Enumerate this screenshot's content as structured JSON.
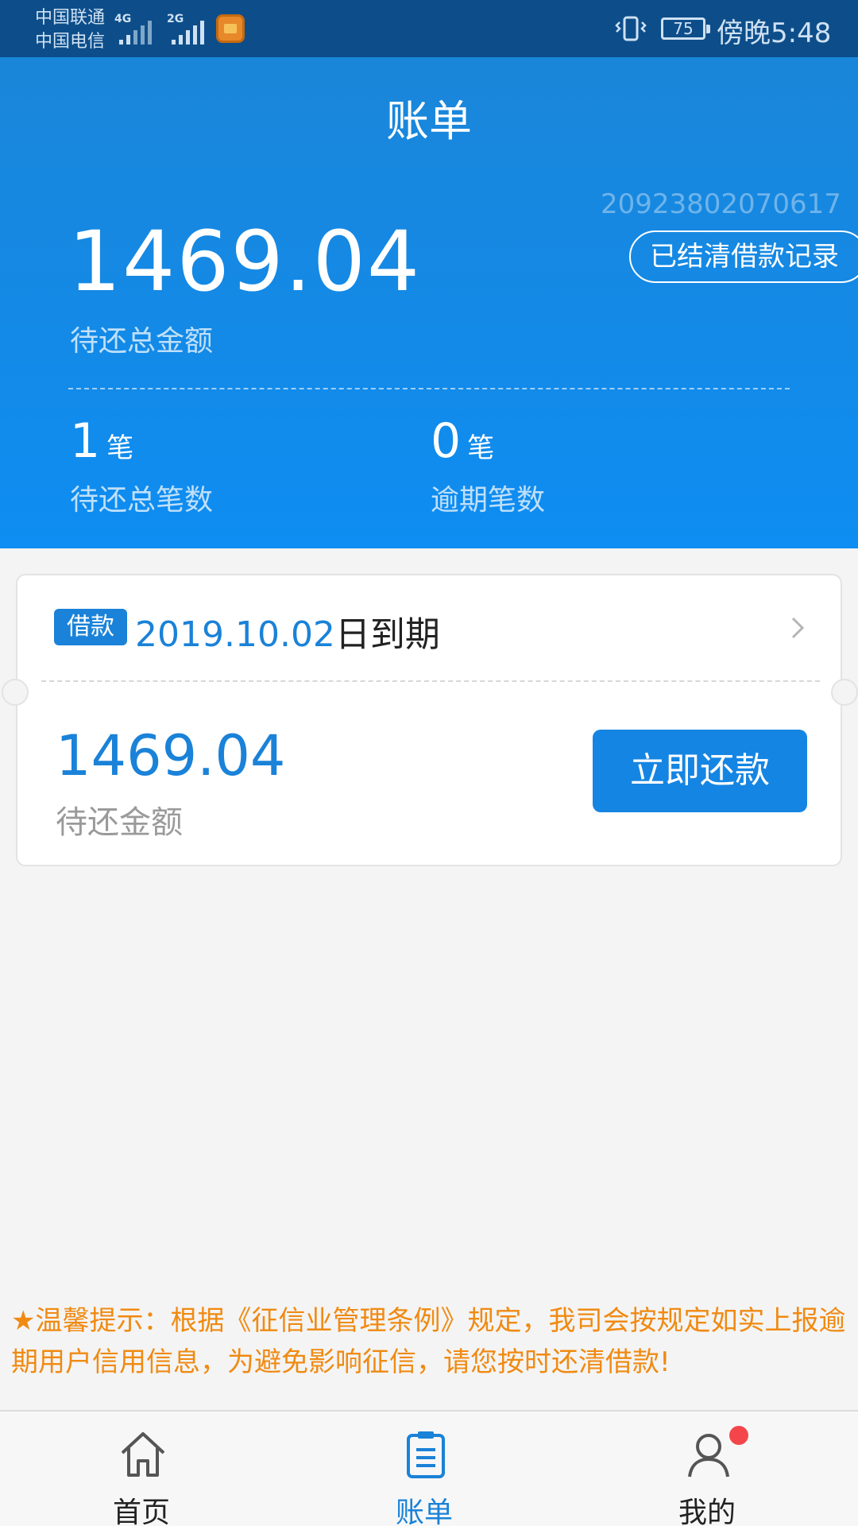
{
  "status_bar": {
    "carrier_1": "中国联通",
    "carrier_2": "中国电信",
    "network_1": "4G",
    "network_2": "2G",
    "battery": "75",
    "time": "傍晚5:48"
  },
  "header": {
    "title": "账单",
    "account_no": "20923802070617",
    "settled_button": "已结清借款记录",
    "total_amount": "1469.04",
    "total_amount_label": "待还总金额",
    "pending_count": "1",
    "pending_unit": "笔",
    "pending_label": "待还总笔数",
    "overdue_count": "0",
    "overdue_unit": "笔",
    "overdue_label": "逾期笔数"
  },
  "loan_card": {
    "tag": "借款",
    "due_date": "2019.10.02",
    "due_suffix": "日到期",
    "amount": "1469.04",
    "amount_label": "待还金额",
    "repay_button": "立即还款"
  },
  "tip": {
    "text": "★温馨提示：根据《征信业管理条例》规定，我司会按规定如实上报逾期用户信用信息，为避免影响征信，请您按时还清借款!"
  },
  "bottom_nav": {
    "items": [
      {
        "label": "首页",
        "icon": "home-icon"
      },
      {
        "label": "账单",
        "icon": "bill-icon"
      },
      {
        "label": "我的",
        "icon": "user-icon"
      }
    ],
    "active_index": 1
  },
  "colors": {
    "accent": "#1a82d8",
    "header_top": "#1a86d9",
    "header_bottom": "#0e8df2",
    "tip": "#f08a12",
    "badge": "#f4464a"
  }
}
